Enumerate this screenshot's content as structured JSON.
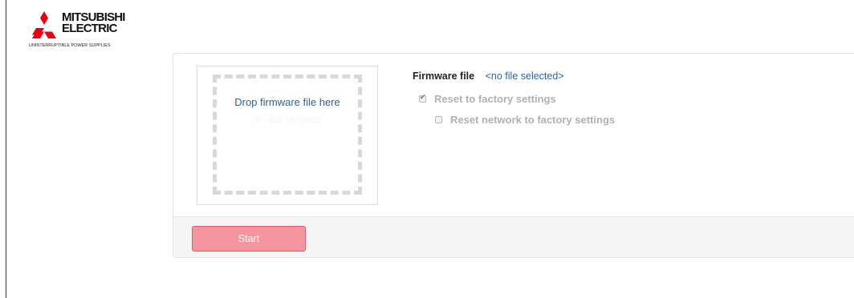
{
  "brand": {
    "name_line1": "MITSUBISHI",
    "name_line2": "ELECTRIC",
    "tagline": "UNINTERRUPTIBLE POWER SUPPLIES",
    "color": "#e60012"
  },
  "dropzone": {
    "title": "Drop firmware file here",
    "subtitle": "or click to select"
  },
  "firmware": {
    "label": "Firmware file",
    "value": "<no file selected>"
  },
  "options": {
    "reset_factory": {
      "label": "Reset to factory settings",
      "checked": true,
      "disabled": true
    },
    "reset_network": {
      "label": "Reset network to factory settings",
      "checked": false,
      "disabled": true
    }
  },
  "footer": {
    "start_label": "Start",
    "start_color": "#f4949f"
  }
}
